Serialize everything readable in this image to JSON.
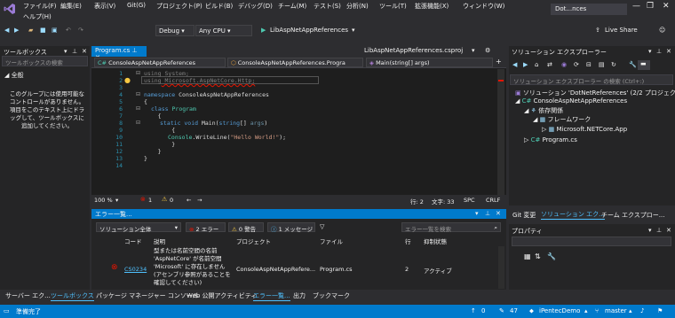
{
  "menu": {
    "items": [
      "ファイル(F)",
      "編集(E)",
      "表示(V)",
      "Git(G)",
      "プロジェクト(P)",
      "ビルド(B)",
      "デバッグ(D)",
      "チーム(M)",
      "テスト(S)",
      "分析(N)",
      "ツール(T)",
      "拡張機能(X)",
      "ウィンドウ(W)"
    ],
    "help": "ヘルプ(H)",
    "title_box": "Dot...nces",
    "min": "—",
    "max": "❐",
    "close": "✕"
  },
  "toolbar": {
    "config": "Debug",
    "platform": "Any CPU",
    "run_target": "LibAspNetAppReferences",
    "live_share": "Live Share"
  },
  "toolbox": {
    "title": "ツールボックス",
    "search_placeholder": "ツールボックスの検索",
    "group": "全般",
    "message": "このグループには使用可能なコントロールがありません。項目をこのテキスト上にドラッグして、ツールボックスに追加してください。"
  },
  "editor": {
    "active_tab": "Program.cs",
    "other_tab": "LibAspNetAppReferences.csproj",
    "nav_project": "ConsoleAspNetAppReferences",
    "nav_class": "ConsoleAspNetAppReferences.Progra",
    "nav_member": "Main(string[] args)",
    "line_numbers": [
      "1",
      "2",
      "3",
      "4",
      "5",
      "6",
      "7",
      "8",
      "9",
      "10",
      "11",
      "12",
      "13",
      "14"
    ],
    "code": {
      "l1_kw": "using",
      "l1_rest": " System;",
      "l2_kw": "using",
      "l2_rest": " Microsoft.AspNetCore.Http;",
      "l4_kw": "namespace",
      "l4_rest": " ConsoleAspNetAppReferences",
      "l5": "{",
      "l6_kw": "class",
      "l6_ty": " Program",
      "l7": "    {",
      "l8_kw": "static void",
      "l8_rest": " Main(",
      "l8_kw2": "string",
      "l8_rest2": "[] ",
      "l8_arg": "args",
      "l8_end": ")",
      "l9": "        {",
      "l10_ty": "Console",
      "l10_rest": ".WriteLine(",
      "l10_st": "\"Hello World!\"",
      "l10_end": ");",
      "l11": "        }",
      "l12": "    }",
      "l13": "}"
    },
    "zoom": "100 %",
    "errors": "1",
    "warnings": "0",
    "row": "行: 2",
    "col": "文字: 33",
    "spc": "SPC",
    "crlf": "CRLF"
  },
  "error_list": {
    "title": "エラー一覧...",
    "scope": "ソリューション全体",
    "errors_btn": "2 エラー",
    "warnings_btn": "0 警告",
    "messages_btn": "1 メッセージ",
    "search_placeholder": "エラー一覧を検索",
    "columns": [
      "コード",
      "説明",
      "プロジェクト",
      "ファイル",
      "行",
      "抑制状態"
    ],
    "row": {
      "code": "CS0234",
      "desc": "型または名前空間の名前 'AspNetCore' が名前空間 'Microsoft' に存在しません (アセンブリ参照があることを確認してください)",
      "project": "ConsoleAspNetAppRefere...",
      "file": "Program.cs",
      "line": "2",
      "state": "アクティブ"
    }
  },
  "solution": {
    "title": "ソリューション エクスプローラー",
    "search_placeholder": "ソリューション エクスプローラー の検索 (Ctrl+:)",
    "items": [
      "ソリューション 'DotNetReferences' (2/2 プロジェク",
      "ConsoleAspNetAppReferences",
      "依存関係",
      "フレームワーク",
      "Microsoft.NETCore.App",
      "Program.cs"
    ],
    "tabs": [
      "Git 変更",
      "ソリューション エク...",
      "チーム エクスプロー..."
    ],
    "properties_title": "プロパティ"
  },
  "bottom_tabs": [
    "サーバー エク...",
    "ツールボックス",
    "パッケージ マネージャー コンソール",
    "Web 公開アクティビティ",
    "エラー一覧...",
    "出力",
    "ブックマーク"
  ],
  "status": {
    "ready": "準備完了",
    "up": "0",
    "pencil": "47",
    "repo": "iPentecDemo",
    "branch": "master"
  },
  "colors": {
    "accent": "#007acc",
    "background": "#1e1e1e",
    "error": "#e51400"
  }
}
